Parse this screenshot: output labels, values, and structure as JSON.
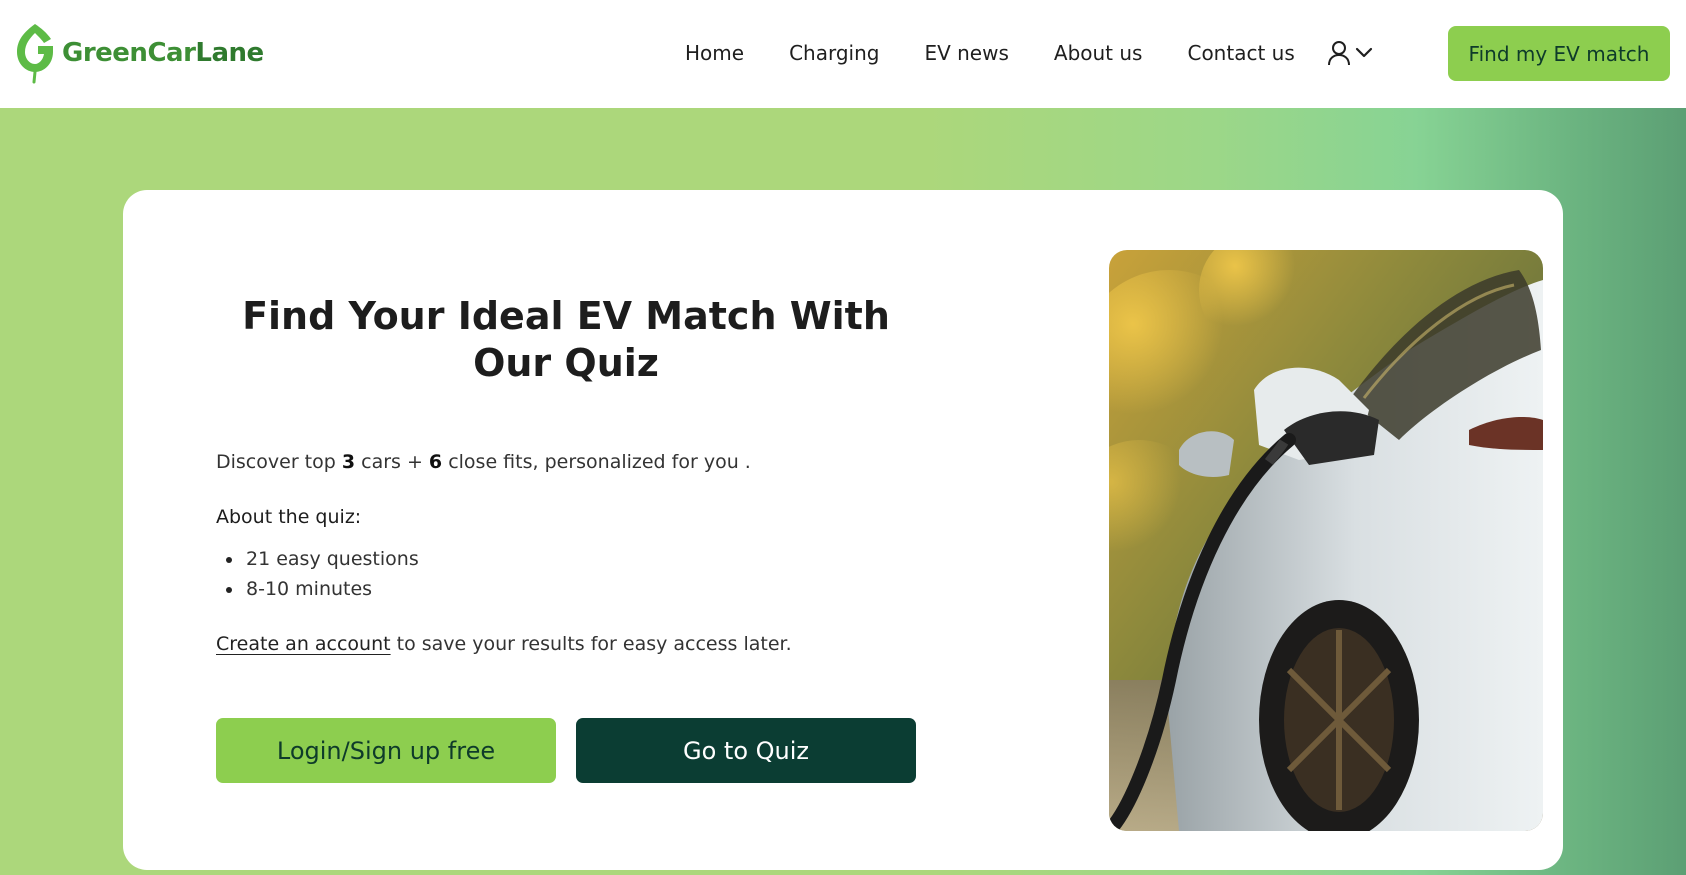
{
  "brand": {
    "name_part1": "GreenCar",
    "name_part2": "Lane",
    "primary_color": "#8dce4f",
    "dark_color": "#0b3d33",
    "logo_icon": "leaf-g-logo-icon"
  },
  "nav": {
    "items": [
      {
        "label": "Home"
      },
      {
        "label": "Charging"
      },
      {
        "label": "EV news"
      },
      {
        "label": "About us"
      },
      {
        "label": "Contact us"
      }
    ],
    "user_icon": "user-icon",
    "dropdown_icon": "chevron-down-icon",
    "cta_label": "Find my EV match"
  },
  "hero": {
    "title": "Find Your Ideal EV Match With Our Quiz",
    "intro": {
      "prefix": "Discover top ",
      "top_count": "3",
      "middle": " cars + ",
      "close_count": "6",
      "suffix": " close fits, personalized for you ."
    },
    "about_heading": "About the quiz:",
    "about_items": [
      {
        "text": "21 easy questions"
      },
      {
        "text": "8-10 minutes"
      }
    ],
    "account_link": "Create an account",
    "account_suffix": " to save your results for easy access later.",
    "login_button": "Login/Sign up free",
    "quiz_button": "Go to Quiz",
    "image_alt": "Electric car charging"
  }
}
